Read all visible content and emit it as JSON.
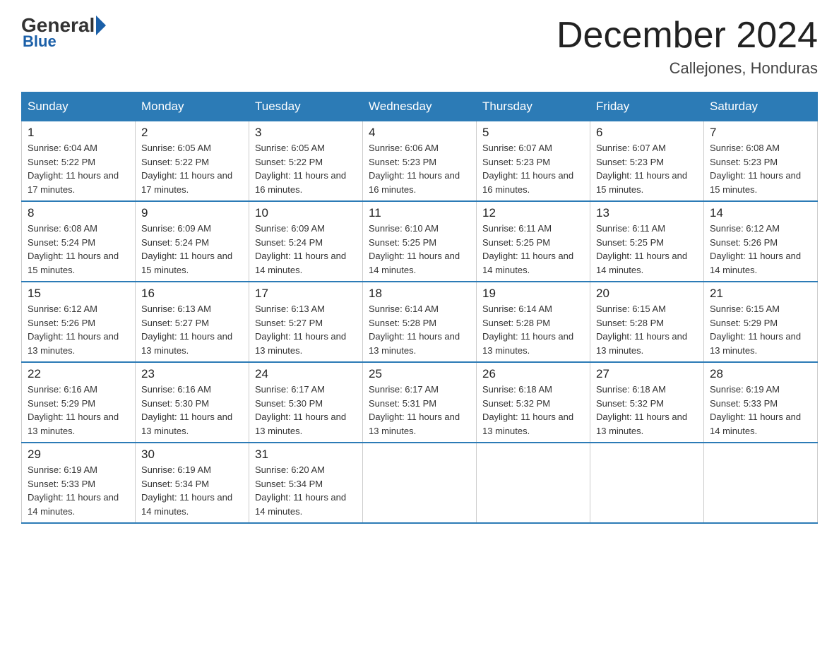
{
  "logo": {
    "general": "General",
    "blue": "Blue"
  },
  "title": "December 2024",
  "subtitle": "Callejones, Honduras",
  "days_header": [
    "Sunday",
    "Monday",
    "Tuesday",
    "Wednesday",
    "Thursday",
    "Friday",
    "Saturday"
  ],
  "weeks": [
    [
      {
        "day": "1",
        "sunrise": "6:04 AM",
        "sunset": "5:22 PM",
        "daylight": "11 hours and 17 minutes."
      },
      {
        "day": "2",
        "sunrise": "6:05 AM",
        "sunset": "5:22 PM",
        "daylight": "11 hours and 17 minutes."
      },
      {
        "day": "3",
        "sunrise": "6:05 AM",
        "sunset": "5:22 PM",
        "daylight": "11 hours and 16 minutes."
      },
      {
        "day": "4",
        "sunrise": "6:06 AM",
        "sunset": "5:23 PM",
        "daylight": "11 hours and 16 minutes."
      },
      {
        "day": "5",
        "sunrise": "6:07 AM",
        "sunset": "5:23 PM",
        "daylight": "11 hours and 16 minutes."
      },
      {
        "day": "6",
        "sunrise": "6:07 AM",
        "sunset": "5:23 PM",
        "daylight": "11 hours and 15 minutes."
      },
      {
        "day": "7",
        "sunrise": "6:08 AM",
        "sunset": "5:23 PM",
        "daylight": "11 hours and 15 minutes."
      }
    ],
    [
      {
        "day": "8",
        "sunrise": "6:08 AM",
        "sunset": "5:24 PM",
        "daylight": "11 hours and 15 minutes."
      },
      {
        "day": "9",
        "sunrise": "6:09 AM",
        "sunset": "5:24 PM",
        "daylight": "11 hours and 15 minutes."
      },
      {
        "day": "10",
        "sunrise": "6:09 AM",
        "sunset": "5:24 PM",
        "daylight": "11 hours and 14 minutes."
      },
      {
        "day": "11",
        "sunrise": "6:10 AM",
        "sunset": "5:25 PM",
        "daylight": "11 hours and 14 minutes."
      },
      {
        "day": "12",
        "sunrise": "6:11 AM",
        "sunset": "5:25 PM",
        "daylight": "11 hours and 14 minutes."
      },
      {
        "day": "13",
        "sunrise": "6:11 AM",
        "sunset": "5:25 PM",
        "daylight": "11 hours and 14 minutes."
      },
      {
        "day": "14",
        "sunrise": "6:12 AM",
        "sunset": "5:26 PM",
        "daylight": "11 hours and 14 minutes."
      }
    ],
    [
      {
        "day": "15",
        "sunrise": "6:12 AM",
        "sunset": "5:26 PM",
        "daylight": "11 hours and 13 minutes."
      },
      {
        "day": "16",
        "sunrise": "6:13 AM",
        "sunset": "5:27 PM",
        "daylight": "11 hours and 13 minutes."
      },
      {
        "day": "17",
        "sunrise": "6:13 AM",
        "sunset": "5:27 PM",
        "daylight": "11 hours and 13 minutes."
      },
      {
        "day": "18",
        "sunrise": "6:14 AM",
        "sunset": "5:28 PM",
        "daylight": "11 hours and 13 minutes."
      },
      {
        "day": "19",
        "sunrise": "6:14 AM",
        "sunset": "5:28 PM",
        "daylight": "11 hours and 13 minutes."
      },
      {
        "day": "20",
        "sunrise": "6:15 AM",
        "sunset": "5:28 PM",
        "daylight": "11 hours and 13 minutes."
      },
      {
        "day": "21",
        "sunrise": "6:15 AM",
        "sunset": "5:29 PM",
        "daylight": "11 hours and 13 minutes."
      }
    ],
    [
      {
        "day": "22",
        "sunrise": "6:16 AM",
        "sunset": "5:29 PM",
        "daylight": "11 hours and 13 minutes."
      },
      {
        "day": "23",
        "sunrise": "6:16 AM",
        "sunset": "5:30 PM",
        "daylight": "11 hours and 13 minutes."
      },
      {
        "day": "24",
        "sunrise": "6:17 AM",
        "sunset": "5:30 PM",
        "daylight": "11 hours and 13 minutes."
      },
      {
        "day": "25",
        "sunrise": "6:17 AM",
        "sunset": "5:31 PM",
        "daylight": "11 hours and 13 minutes."
      },
      {
        "day": "26",
        "sunrise": "6:18 AM",
        "sunset": "5:32 PM",
        "daylight": "11 hours and 13 minutes."
      },
      {
        "day": "27",
        "sunrise": "6:18 AM",
        "sunset": "5:32 PM",
        "daylight": "11 hours and 13 minutes."
      },
      {
        "day": "28",
        "sunrise": "6:19 AM",
        "sunset": "5:33 PM",
        "daylight": "11 hours and 14 minutes."
      }
    ],
    [
      {
        "day": "29",
        "sunrise": "6:19 AM",
        "sunset": "5:33 PM",
        "daylight": "11 hours and 14 minutes."
      },
      {
        "day": "30",
        "sunrise": "6:19 AM",
        "sunset": "5:34 PM",
        "daylight": "11 hours and 14 minutes."
      },
      {
        "day": "31",
        "sunrise": "6:20 AM",
        "sunset": "5:34 PM",
        "daylight": "11 hours and 14 minutes."
      },
      null,
      null,
      null,
      null
    ]
  ],
  "colors": {
    "header_bg": "#2c7bb6",
    "header_text": "#ffffff",
    "border": "#2c7bb6",
    "logo_blue": "#1a5fa8"
  }
}
